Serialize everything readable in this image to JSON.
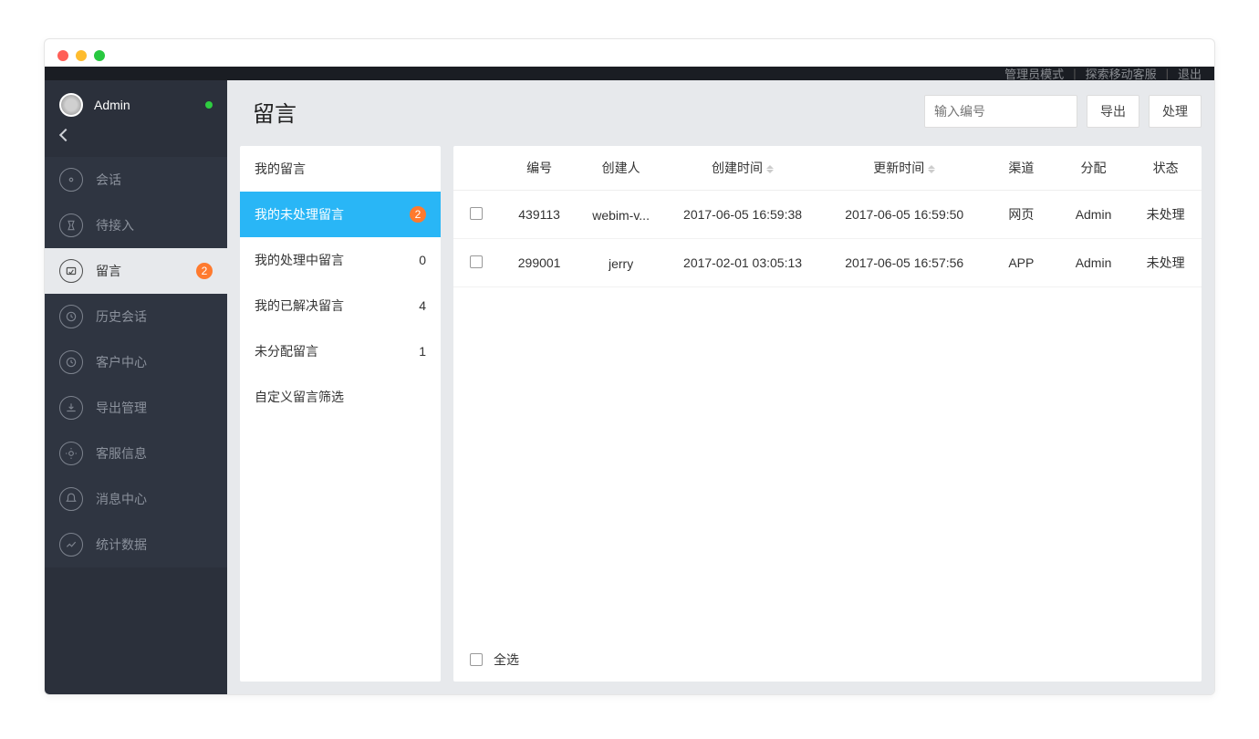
{
  "topbar": {
    "admin_mode": "管理员模式",
    "explore": "探索移动客服",
    "logout": "退出"
  },
  "user": {
    "name": "Admin"
  },
  "sidebar": {
    "items": [
      {
        "label": "会话",
        "icon": "chat-icon"
      },
      {
        "label": "待接入",
        "icon": "pending-icon"
      },
      {
        "label": "留言",
        "icon": "message-icon",
        "badge": "2",
        "active": true
      },
      {
        "label": "历史会话",
        "icon": "history-icon"
      },
      {
        "label": "客户中心",
        "icon": "customer-icon"
      },
      {
        "label": "导出管理",
        "icon": "export-icon"
      },
      {
        "label": "客服信息",
        "icon": "agent-icon"
      },
      {
        "label": "消息中心",
        "icon": "notification-icon"
      },
      {
        "label": "统计数据",
        "icon": "stats-icon"
      }
    ]
  },
  "page": {
    "title": "留言",
    "search_placeholder": "输入编号",
    "export_btn": "导出",
    "process_btn": "处理"
  },
  "filters": [
    {
      "label": "我的留言",
      "count": ""
    },
    {
      "label": "我的未处理留言",
      "count": "2",
      "selected": true,
      "badge": true
    },
    {
      "label": "我的处理中留言",
      "count": "0"
    },
    {
      "label": "我的已解决留言",
      "count": "4"
    },
    {
      "label": "未分配留言",
      "count": "1"
    },
    {
      "label": "自定义留言筛选",
      "count": ""
    }
  ],
  "table": {
    "headers": {
      "id": "编号",
      "creator": "创建人",
      "created": "创建时间",
      "updated": "更新时间",
      "channel": "渠道",
      "assign": "分配",
      "status": "状态"
    },
    "rows": [
      {
        "id": "439113",
        "creator": "webim-v...",
        "created": "2017-06-05 16:59:38",
        "updated": "2017-06-05 16:59:50",
        "channel": "网页",
        "assign": "Admin",
        "status": "未处理"
      },
      {
        "id": "299001",
        "creator": "jerry",
        "created": "2017-02-01 03:05:13",
        "updated": "2017-06-05 16:57:56",
        "channel": "APP",
        "assign": "Admin",
        "status": "未处理"
      }
    ],
    "select_all": "全选"
  }
}
